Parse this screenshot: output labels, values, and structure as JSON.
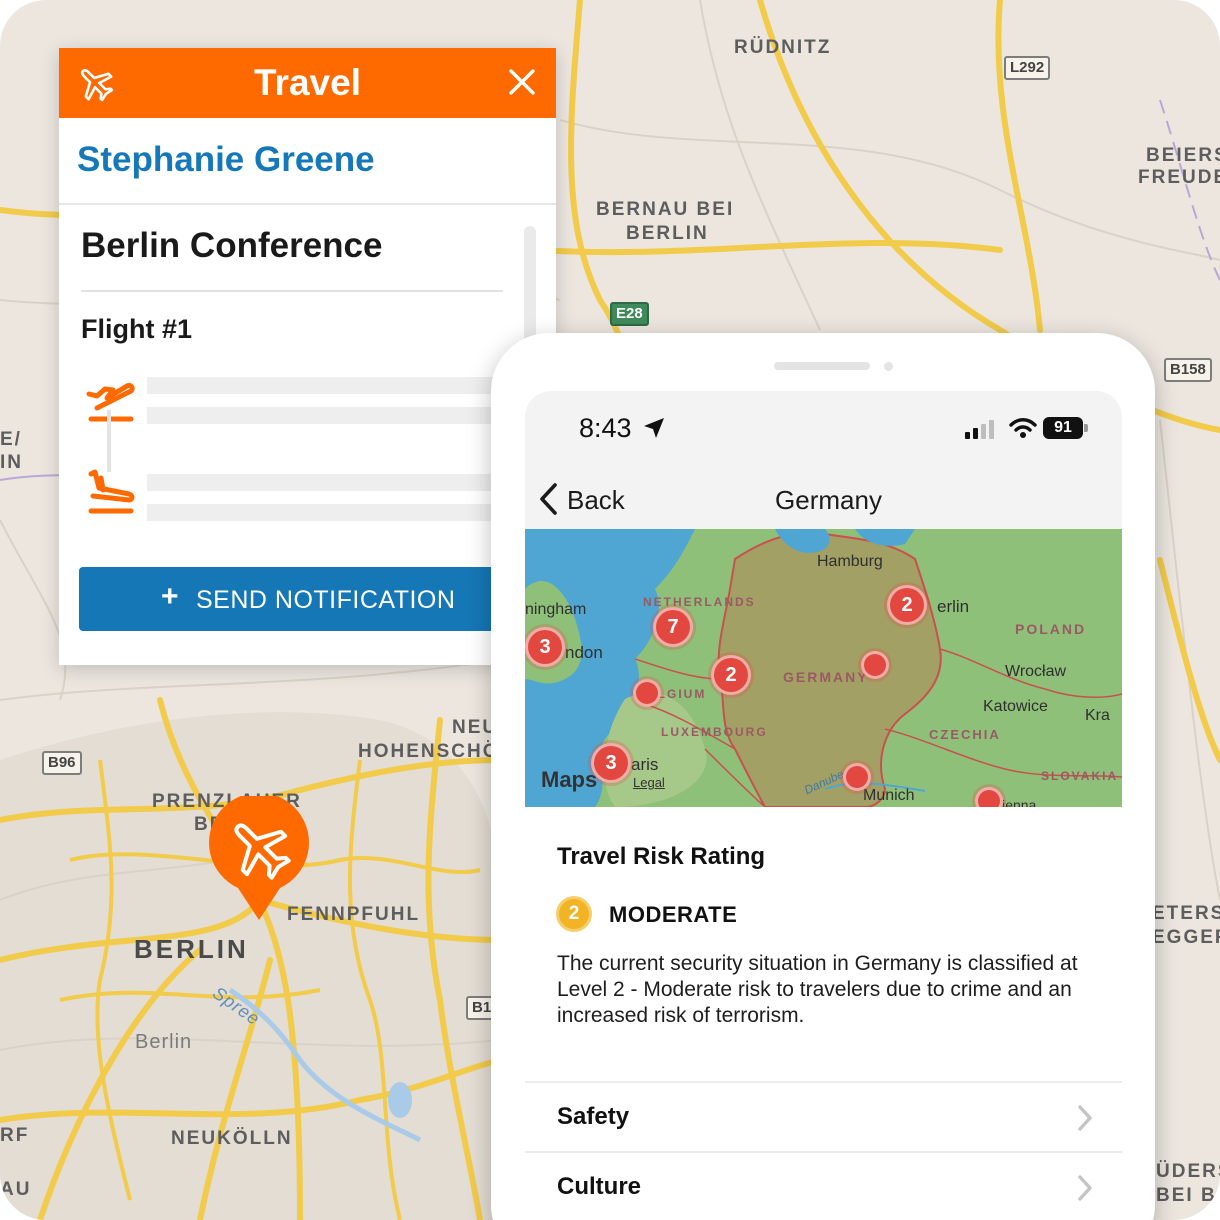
{
  "background_map": {
    "places": {
      "rudnitz": "RÜDNITZ",
      "beiers": "BEIERS",
      "freude": "FREUDE",
      "bernau_1": "BERNAU BEI",
      "bernau_2": "BERLIN",
      "neu": "NEU",
      "hohenscho": "HOHENSCHÖ",
      "prenzlauer_1": "PRENZLAUER",
      "prenzlauer_2": "BE",
      "fennpfuhl": "FENNPFUHL",
      "berlin": "BERLIN",
      "berlin_small": "Berlin",
      "spree": "Spree",
      "neukolln": "NEUKÖLLN",
      "left_e": "E/",
      "left_in": "IN",
      "left_rf": "RF",
      "left_au": "AU",
      "right_eters": "ETERS",
      "right_egger": "EGGER",
      "right_uder": "ÜDERS",
      "right_beib": "BEI B"
    },
    "roads": {
      "l292": "L292",
      "e28": "E28",
      "b158": "B158",
      "b96": "B96",
      "b1": "B1"
    }
  },
  "travel_card": {
    "title": "Travel",
    "traveler_name": "Stephanie Greene",
    "trip_title": "Berlin Conference",
    "flight_label": "Flight #1",
    "send_button_plus": "+",
    "send_button_label": "SEND NOTIFICATION",
    "header_color": "#ff6a00",
    "accent_color": "#1578b8"
  },
  "phone": {
    "status": {
      "time": "8:43",
      "battery": "91"
    },
    "nav": {
      "back_label": "Back",
      "title": "Germany"
    },
    "map": {
      "cities": {
        "hamburg": "Hamburg",
        "berlin": "erlin",
        "birmingham": "ningham",
        "london": "ndon",
        "wroclaw": "Wrocław",
        "katowice": "Katowice",
        "krakow": "Kra",
        "paris": "aris",
        "munich": "Munich",
        "danube": "Danube",
        "vienna": "Vienna"
      },
      "countries": {
        "netherlands": "NETHERLANDS",
        "poland": "POLAND",
        "germany": "GERMANY",
        "belgium": "BELGIUM",
        "luxembourg": "LUXEMBOURG",
        "czechia": "CZECHIA",
        "slovakia": "SLOVAKIA"
      },
      "clusters": {
        "berlin": "2",
        "netherlands": "7",
        "london": "3",
        "belgium": "2",
        "paris": "3"
      },
      "maps_logo": "Maps",
      "legal": "Legal"
    },
    "risk": {
      "title": "Travel Risk Rating",
      "level_number": "2",
      "level_label": "MODERATE",
      "description": "The current security situation in Germany is classified at Level 2 - Moderate risk to travelers due to crime and an increased risk of terrorism.",
      "badge_color": "#f2b324"
    },
    "sections": [
      {
        "label": "Safety"
      },
      {
        "label": "Culture"
      }
    ]
  }
}
